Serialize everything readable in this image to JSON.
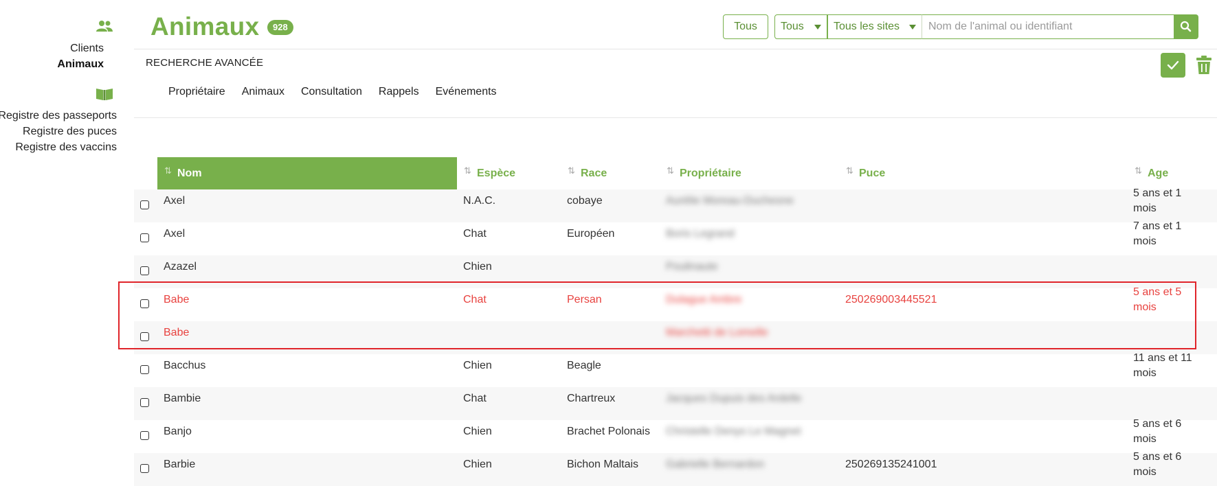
{
  "sidebar": {
    "clients_label": "Clients",
    "animaux_label": "Animaux",
    "registres": [
      "Registre des passeports",
      "Registre des puces",
      "Registre des vaccins"
    ]
  },
  "header": {
    "title": "Animaux",
    "count": "928",
    "tous_button": "Tous",
    "species_select": "Tous",
    "sites_select": "Tous les sites",
    "search_placeholder": "Nom de l'animal ou identifiant"
  },
  "advanced": {
    "label": "RECHERCHE AVANCÉE",
    "filters": [
      "Propriétaire",
      "Animaux",
      "Consultation",
      "Rappels",
      "Evénements"
    ]
  },
  "table": {
    "columns": {
      "nom": "Nom",
      "espece": "Espèce",
      "race": "Race",
      "proprietaire": "Propriétaire",
      "puce": "Puce",
      "age": "Age"
    },
    "rows": [
      {
        "nom": "Axel",
        "espece": "N.A.C.",
        "race": "cobaye",
        "proprietaire": "Aurélie Moreau-Duchesne",
        "puce": "",
        "age_1": "5 ans et 1",
        "age_2": "mois"
      },
      {
        "nom": "Axel",
        "espece": "Chat",
        "race": "Européen",
        "proprietaire": "Boris Legrand",
        "puce": "",
        "age_1": "7 ans et 1",
        "age_2": "mois"
      },
      {
        "nom": "Azazel",
        "espece": "Chien",
        "race": "",
        "proprietaire": "Poulinaute",
        "puce": "",
        "age_1": "",
        "age_2": ""
      },
      {
        "nom": "Babe",
        "espece": "Chat",
        "race": "Persan",
        "proprietaire": "Dulague Ambre",
        "puce": "250269003445521",
        "age_1": "5 ans et 5",
        "age_2": "mois"
      },
      {
        "nom": "Babe",
        "espece": "",
        "race": "",
        "proprietaire": "Marchetti de Lomelle",
        "puce": "",
        "age_1": "",
        "age_2": ""
      },
      {
        "nom": "Bacchus",
        "espece": "Chien",
        "race": "Beagle",
        "proprietaire": "",
        "puce": "",
        "age_1": "11 ans et 11",
        "age_2": "mois"
      },
      {
        "nom": "Bambie",
        "espece": "Chat",
        "race": "Chartreux",
        "proprietaire": "Jacques Dupuis des Ardelle",
        "puce": "",
        "age_1": "",
        "age_2": ""
      },
      {
        "nom": "Banjo",
        "espece": "Chien",
        "race": "Brachet Polonais",
        "proprietaire": "Christelle Denys Le Magnet",
        "puce": "",
        "age_1": "5 ans et 6",
        "age_2": "mois"
      },
      {
        "nom": "Barbie",
        "espece": "Chien",
        "race": "Bichon Maltais",
        "proprietaire": "Gabrielle Bernardon",
        "puce": "250269135241001",
        "age_1": "5 ans et 6",
        "age_2": "mois"
      }
    ]
  },
  "colors": {
    "accent": "#78b04b",
    "highlight": "#e8423f",
    "highlight_border": "#e0242a"
  }
}
